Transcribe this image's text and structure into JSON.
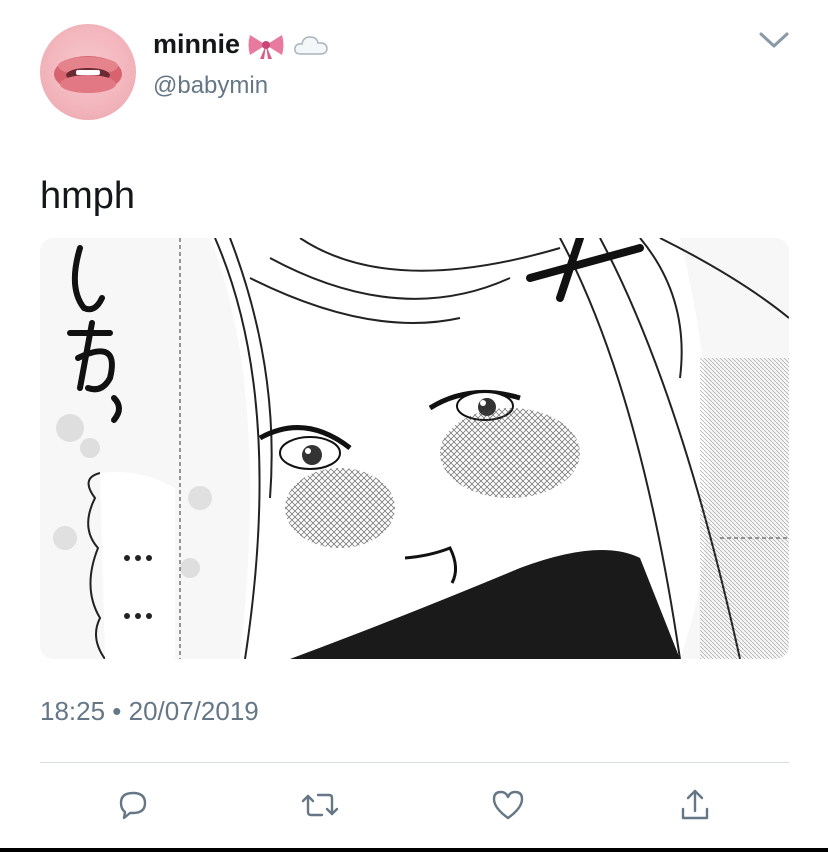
{
  "tweet": {
    "display_name": "minnie",
    "name_emojis": [
      "bow-emoji",
      "cloud-emoji"
    ],
    "handle": "@babymin",
    "text": "hmph",
    "timestamp": "18:25 • 20/07/2019",
    "media": {
      "kind": "manga panel",
      "sfx_text": "しわっ",
      "ellipsis_1": "…",
      "ellipsis_2": "…"
    }
  },
  "actions": {
    "icons": [
      "reply-icon",
      "retweet-icon",
      "like-icon",
      "share-icon"
    ]
  },
  "colors": {
    "text": "#14171a",
    "secondary": "#657786",
    "icon": "#657786",
    "divider": "#d8dde1",
    "bow": "#e87aa0"
  }
}
